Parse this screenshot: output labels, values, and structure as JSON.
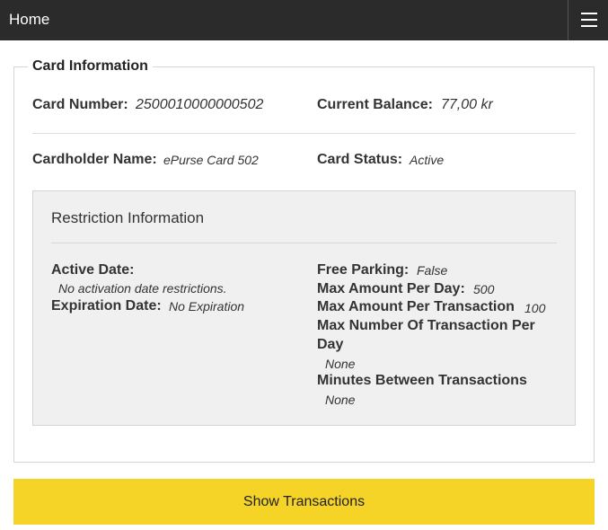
{
  "header": {
    "title": "Home",
    "menu_icon": "hamburger-icon"
  },
  "card_info": {
    "legend": "Card Information",
    "card_number_label": "Card Number:",
    "card_number": "2500010000000502",
    "balance_label": "Current Balance:",
    "balance": "77,00 kr",
    "holder_label": "Cardholder Name:",
    "holder": "ePurse Card 502",
    "status_label": "Card Status:",
    "status": "Active"
  },
  "restrictions": {
    "title": "Restriction Information",
    "active_date_label": "Active Date:",
    "active_date": "No activation date restrictions.",
    "expiration_label": "Expiration Date:",
    "expiration": "No Expiration",
    "free_parking_label": "Free Parking:",
    "free_parking": "False",
    "max_per_day_label": "Max Amount Per Day:",
    "max_per_day": "500",
    "max_per_tx_label": "Max Amount Per Transaction",
    "max_per_tx": "100",
    "max_tx_per_day_label": "Max Number Of Transaction Per Day",
    "max_tx_per_day": "None",
    "minutes_between_label": "Minutes Between Transactions",
    "minutes_between": "None"
  },
  "actions": {
    "show_transactions": "Show Transactions"
  },
  "colors": {
    "header_bg": "#2b2b2b",
    "accent": "#f5d327",
    "restrict_bg": "#f0f0f0"
  }
}
